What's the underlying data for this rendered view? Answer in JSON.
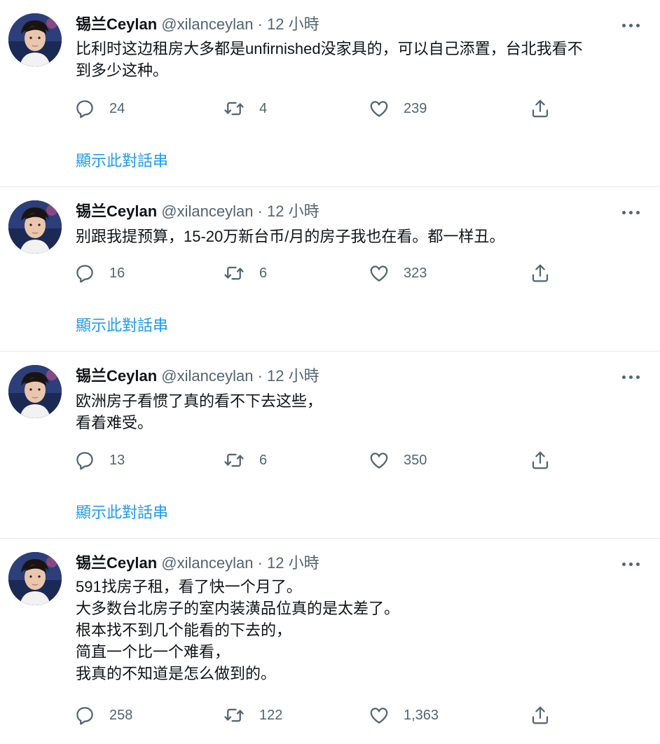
{
  "user": {
    "name": "锡兰Ceylan",
    "handle": "@xilanceylan",
    "separator": "·"
  },
  "show_thread_label": "顯示此對話串",
  "tweets": [
    {
      "time": "12 小時",
      "lines": [
        "比利时这边租房大多都是unfirnished没家具的，可以自己添置，台北我看不",
        "到多少这种。"
      ],
      "replies": "24",
      "retweets": "4",
      "likes": "239"
    },
    {
      "time": "12 小時",
      "lines": [
        "别跟我提预算，15-20万新台币/月的房子我也在看。都一样丑。"
      ],
      "replies": "16",
      "retweets": "6",
      "likes": "323"
    },
    {
      "time": "12 小時",
      "lines": [
        "欧洲房子看惯了真的看不下去这些，",
        "看着难受。"
      ],
      "replies": "13",
      "retweets": "6",
      "likes": "350"
    },
    {
      "time": "12 小時",
      "lines": [
        "591找房子租，看了快一个月了。",
        "大多数台北房子的室内装潢品位真的是太差了。",
        "根本找不到几个能看的下去的，",
        "简直一个比一个难看，",
        "我真的不知道是怎么做到的。"
      ],
      "replies": "258",
      "retweets": "122",
      "likes": "1,363"
    }
  ],
  "icons": {
    "reply": "reply-icon",
    "retweet": "retweet-icon",
    "like": "heart-icon",
    "share": "share-icon",
    "more": "more-icon"
  },
  "colors": {
    "link": "#1d9bf0",
    "secondary": "#536471",
    "divider": "#e6ecf0"
  }
}
